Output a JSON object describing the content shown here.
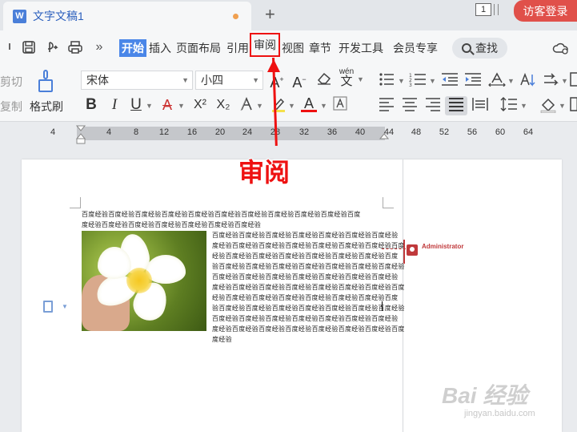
{
  "titlebar": {
    "doc_icon_letter": "W",
    "doc_title": "文字文稿1",
    "new_tab": "+",
    "page_count": "1",
    "login_label": "访客登录"
  },
  "menubar": {
    "overflow": "»",
    "tabs": [
      {
        "label": "开始",
        "active": true
      },
      {
        "label": "插入"
      },
      {
        "label": "页面布局"
      },
      {
        "label": "引用"
      },
      {
        "label": "审阅",
        "highlighted": true
      },
      {
        "label": "视图"
      },
      {
        "label": "章节"
      },
      {
        "label": "开发工具"
      },
      {
        "label": "会员专享"
      }
    ],
    "search_label": "查找"
  },
  "toolbar": {
    "cut_label": "剪切",
    "copy_label": "复制",
    "format_painter_label": "格式刷",
    "font_name": "宋体",
    "font_size": "小四",
    "bold": "B",
    "italic": "I",
    "underline": "U",
    "strike": "A",
    "superscript": "X²",
    "subscript": "X₂",
    "font_color": "A",
    "pinyin": "wén"
  },
  "ruler": {
    "ticks": [
      "4",
      "2",
      "2",
      "4",
      "6",
      "8",
      "10",
      "12",
      "14",
      "16",
      "18",
      "20",
      "22",
      "24",
      "26",
      "28",
      "30",
      "32",
      "34",
      "36",
      "38",
      "40",
      "42",
      "44",
      "46",
      "48",
      "50",
      "52",
      "54",
      "56",
      "58",
      "60",
      "62",
      "64"
    ],
    "labels": [
      "4",
      "4",
      "8",
      "12",
      "16",
      "20",
      "24",
      "28",
      "32",
      "36",
      "40",
      "44",
      "48",
      "52",
      "56",
      "60",
      "64"
    ]
  },
  "document": {
    "top_lines": [
      "百度经验百度经验百度经验百度经验百度经验百度经验百度经验百度经验百度经验百度经验百度",
      "度经验百度经验百度经验百度经验百度经验百度经验百度经验"
    ],
    "wrap_lines": [
      "百度经验百度经验百度经验百度经验百度经验百度经验百度经验",
      "度经验百度经验百度经验百度经验百度经验百度经验百度经验百度",
      "经验百度经验百度经验百度经验百度经验百度经验百度经验百度",
      "验百度经验百度经验百度经验百度经验百度经验百度经验百度经验",
      "百度经验百度经验百度经验百度经验百度经验百度经验百度经验",
      "度经验百度经验百度经验百度经验百度经验百度经验百度经验百度",
      "经验百度经验百度经验百度经验百度经验百度经验百度经验百度",
      "验百度经验百度经验百度经验百度经验百度经验百度经验百度经验",
      "百度经验百度经验百度经验百度经验百度经验百度经验百度经验",
      "度经验百度经验百度经验百度经验百度经验百度经验百度经验百度",
      "度经验"
    ],
    "comment_author": "Administrator"
  },
  "annotation": {
    "label": "审阅",
    "color": "#ee1111"
  },
  "watermark": {
    "main": "Bai 经验",
    "sub": "jingyan.baidu.com"
  },
  "colors": {
    "accent": "#4a86e8",
    "login": "#e0504a",
    "comment": "#c0393b"
  }
}
